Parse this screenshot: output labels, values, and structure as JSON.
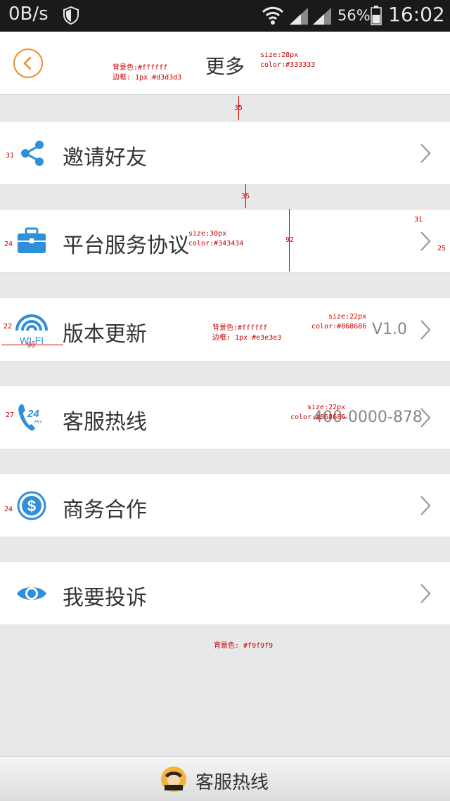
{
  "statusbar": {
    "net_speed": "0B/s",
    "battery_pct": "56%",
    "time": "16:02"
  },
  "header": {
    "title": "更多"
  },
  "rows": [
    {
      "label": "邀请好友",
      "value": "",
      "icon": "share-icon"
    },
    {
      "label": "平台服务协议",
      "value": "",
      "icon": "briefcase-icon"
    },
    {
      "label": "版本更新",
      "value": "V1.0",
      "icon": "wifi-icon"
    },
    {
      "label": "客服热线",
      "value": "400-0000-878",
      "icon": "phone-24hrs-icon"
    },
    {
      "label": "商务合作",
      "value": "",
      "icon": "dollar-icon"
    },
    {
      "label": "我要投诉",
      "value": "",
      "icon": "eye-icon"
    }
  ],
  "icon_labels": {
    "wifi": "WI-FI",
    "hours_num": "24",
    "hours_unit": "Hrs"
  },
  "bottombar": {
    "label": "客服热线"
  },
  "annotations": {
    "header_bg": "背景色:#ffffff",
    "header_border": "边框: 1px #d3d3d3",
    "title_size": "size:28px",
    "title_color": "color:#333333",
    "gap1": "35",
    "gap2": "35",
    "left_share": "31",
    "left_brief": "24",
    "label_size": "size:30px",
    "label_color": "color:#343434",
    "row_height": "92",
    "chev_top": "31",
    "chev_right": "25",
    "left_wifi": "22",
    "wifi_width": "90",
    "row_bg": "背景色:#ffffff",
    "row_border": "边框: 1px  #e3e3e3",
    "value_size": "size:22px",
    "value_color": "color:#868686",
    "left_phone": "27",
    "phone_size": "size:22px",
    "phone_color": "color:#868686",
    "left_dollar": "24",
    "page_bg": "背景色: #f9f9f9"
  },
  "colors": {
    "accent": "#f08a2c",
    "icon_blue": "#2f8fd8",
    "text": "#343434",
    "value": "#868686"
  }
}
